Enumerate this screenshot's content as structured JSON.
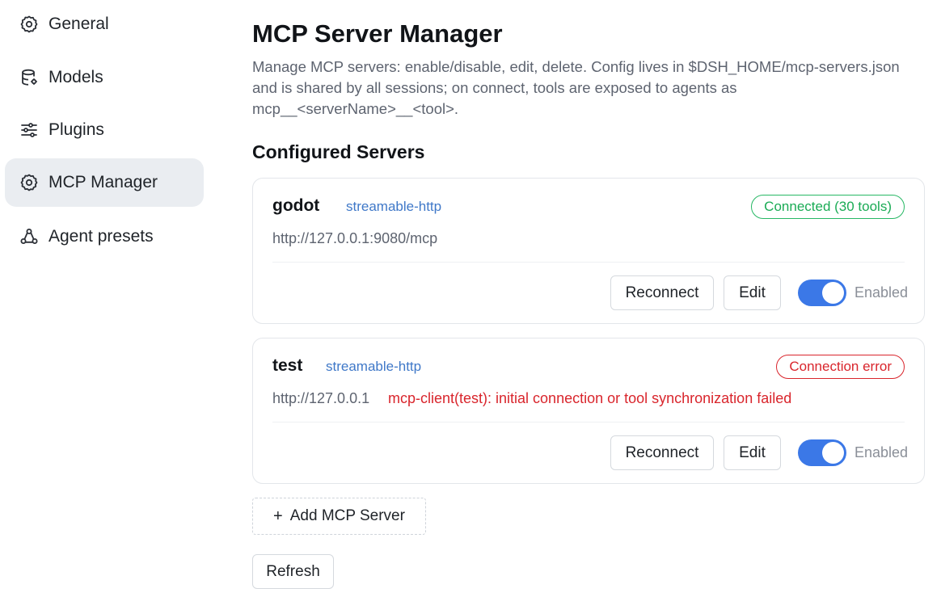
{
  "sidebar": {
    "items": [
      {
        "label": "General",
        "icon": "gear-icon",
        "active": false
      },
      {
        "label": "Models",
        "icon": "database-icon",
        "active": false
      },
      {
        "label": "Plugins",
        "icon": "sliders-icon",
        "active": false
      },
      {
        "label": "MCP Manager",
        "icon": "gear-icon",
        "active": true
      },
      {
        "label": "Agent presets",
        "icon": "agents-icon",
        "active": false
      }
    ]
  },
  "main": {
    "title": "MCP Server Manager",
    "description": "Manage MCP servers: enable/disable, edit, delete. Config lives in $DSH_HOME/mcp-servers.json and is shared by all sessions; on connect, tools are exposed to agents as mcp__<serverName>__<tool>.",
    "section_title": "Configured Servers",
    "servers": [
      {
        "name": "godot",
        "transport": "streamable-http",
        "status": "Connected (30 tools)",
        "status_kind": "ok",
        "url": "http://127.0.0.1:9080/mcp",
        "error": "",
        "reconnect_label": "Reconnect",
        "edit_label": "Edit",
        "enabled": true,
        "enabled_label": "Enabled"
      },
      {
        "name": "test",
        "transport": "streamable-http",
        "status": "Connection error",
        "status_kind": "error",
        "url": "http://127.0.0.1",
        "error": "mcp-client(test): initial connection or tool synchronization failed",
        "reconnect_label": "Reconnect",
        "edit_label": "Edit",
        "enabled": true,
        "enabled_label": "Enabled"
      }
    ],
    "add_button_icon": "+",
    "add_button_label": "Add MCP Server",
    "refresh_label": "Refresh"
  },
  "colors": {
    "accent": "#3b78e7",
    "success": "#28b865",
    "error": "#d9252c",
    "link": "#3f78c8",
    "active_bg": "#eaedf1"
  }
}
